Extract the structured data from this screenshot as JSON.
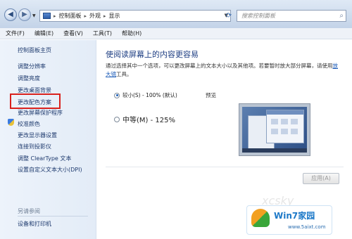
{
  "address": {
    "crumbs": [
      "控制面板",
      "外观",
      "显示"
    ],
    "search_placeholder": "搜索控制面板"
  },
  "menu": [
    "文件(F)",
    "编辑(E)",
    "查看(V)",
    "工具(T)",
    "帮助(H)"
  ],
  "sidebar": {
    "items": [
      "控制面板主页",
      "调整分辨率",
      "调整亮度",
      "更改桌面背景",
      "更改配色方案",
      "更改屏幕保护程序",
      "校准颜色",
      "更改显示器设置",
      "连接到投影仪",
      "调整 ClearType 文本",
      "设置自定义文本大小(DPI)"
    ],
    "see_also": "另请参阅",
    "see_also_items": [
      "设备和打印机"
    ],
    "highlighted_item": "更改配色方案"
  },
  "main": {
    "title": "使阅读屏幕上的内容更容易",
    "description": "通过选择其中一个选项，可以更改屏幕上的文本大小以及其他项。若要暂时放大部分屏幕，请使用",
    "link": "放大镜",
    "description_end": "工具。",
    "options": [
      {
        "label": "较小(S) - 100% (默认)",
        "selected": true
      },
      {
        "label": "中等(M) - 125%",
        "selected": false
      }
    ],
    "preview_label": "预览",
    "apply_label": "应用(A)"
  },
  "watermark": {
    "brand": "Win7家园",
    "url": "www.5aixt.com",
    "faint": "xcsky"
  },
  "colors": {
    "highlight_box": "#d9201c",
    "link": "#1c5bb7",
    "title": "#1f3f83"
  }
}
